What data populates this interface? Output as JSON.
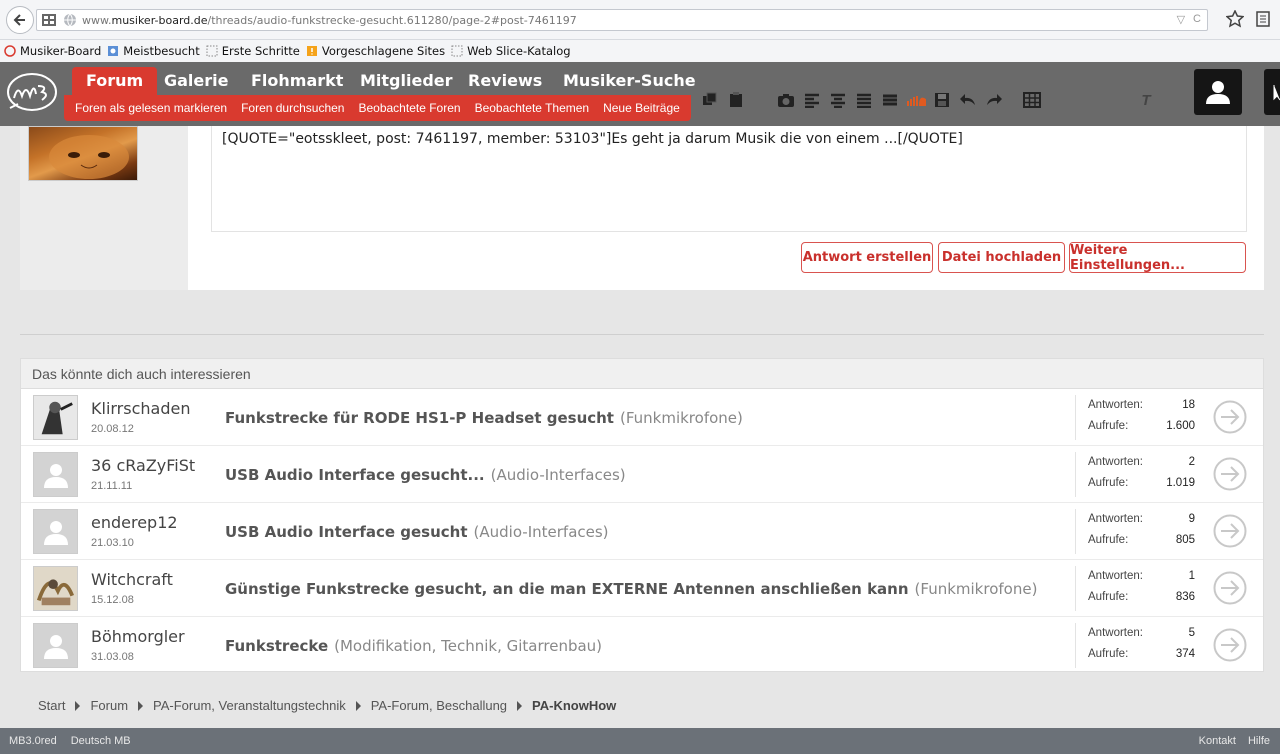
{
  "browser": {
    "url_prefix": "www.",
    "url_domain": "musiker-board.de",
    "url_path": "/threads/audio-funkstrecke-gesucht.611280/page-2#post-7461197",
    "bookmarks": [
      {
        "label": "Musiker-Board",
        "icon": "mb-favicon-icon"
      },
      {
        "label": "Meistbesucht",
        "icon": "blue-page-icon"
      },
      {
        "label": "Erste Schritte",
        "icon": "dotted-page-icon"
      },
      {
        "label": "Vorgeschlagene Sites",
        "icon": "orange-page-icon"
      },
      {
        "label": "Web Slice-Katalog",
        "icon": "dotted-page-icon"
      }
    ]
  },
  "nav": {
    "items": [
      {
        "label": "Forum",
        "active": true
      },
      {
        "label": "Galerie"
      },
      {
        "label": "Flohmarkt"
      },
      {
        "label": "Mitglieder"
      },
      {
        "label": "Reviews"
      },
      {
        "label": "Musiker-Suche"
      }
    ],
    "subnav": [
      "Foren als gelesen markieren",
      "Foren durchsuchen",
      "Beobachtete Foren",
      "Beobachtete Themen",
      "Neue Beiträge"
    ]
  },
  "reply": {
    "editor_text": "[QUOTE=\"eotsskleet, post: 7461197, member: 53103\"]Es geht ja darum Musik die von einem ...[/QUOTE]",
    "buttons": [
      "Antwort erstellen",
      "Datei hochladen",
      "Weitere Einstellungen..."
    ]
  },
  "related": {
    "heading": "Das könnte dich auch interessieren",
    "replies_label": "Antworten:",
    "views_label": "Aufrufe:",
    "threads": [
      {
        "user": "Klirrschaden",
        "date": "20.08.12",
        "title": "Funkstrecke für RODE HS1-P Headset gesucht",
        "forum": "(Funkmikrofone)",
        "replies": "18",
        "views": "1.600",
        "avatar": "photo"
      },
      {
        "user": "36 cRaZyFiSt",
        "date": "21.11.11",
        "title": "USB Audio Interface gesucht...",
        "forum": "(Audio-Interfaces)",
        "replies": "2",
        "views": "1.019",
        "avatar": "default"
      },
      {
        "user": "enderep12",
        "date": "21.03.10",
        "title": "USB Audio Interface gesucht",
        "forum": "(Audio-Interfaces)",
        "replies": "9",
        "views": "805",
        "avatar": "default"
      },
      {
        "user": "Witchcraft",
        "date": "15.12.08",
        "title": "Günstige Funkstrecke gesucht, an die man EXTERNE Antennen anschließen kann",
        "forum": "(Funkmikrofone)",
        "replies": "1",
        "views": "836",
        "avatar": "photo2"
      },
      {
        "user": "Böhmorgler",
        "date": "31.03.08",
        "title": "Funkstrecke",
        "forum": "(Modifikation, Technik, Gitarrenbau)",
        "replies": "5",
        "views": "374",
        "avatar": "default"
      }
    ]
  },
  "breadcrumb": [
    "Start",
    "Forum",
    "PA-Forum, Veranstaltungstechnik",
    "PA-Forum, Beschallung",
    "PA-KnowHow"
  ],
  "footer": {
    "left": [
      "MB3.0red",
      "Deutsch MB"
    ],
    "right": [
      "Kontakt",
      "Hilfe"
    ]
  },
  "colors": {
    "accent": "#d93a2f",
    "navbar": "#464646",
    "footer": "#6b7178"
  }
}
